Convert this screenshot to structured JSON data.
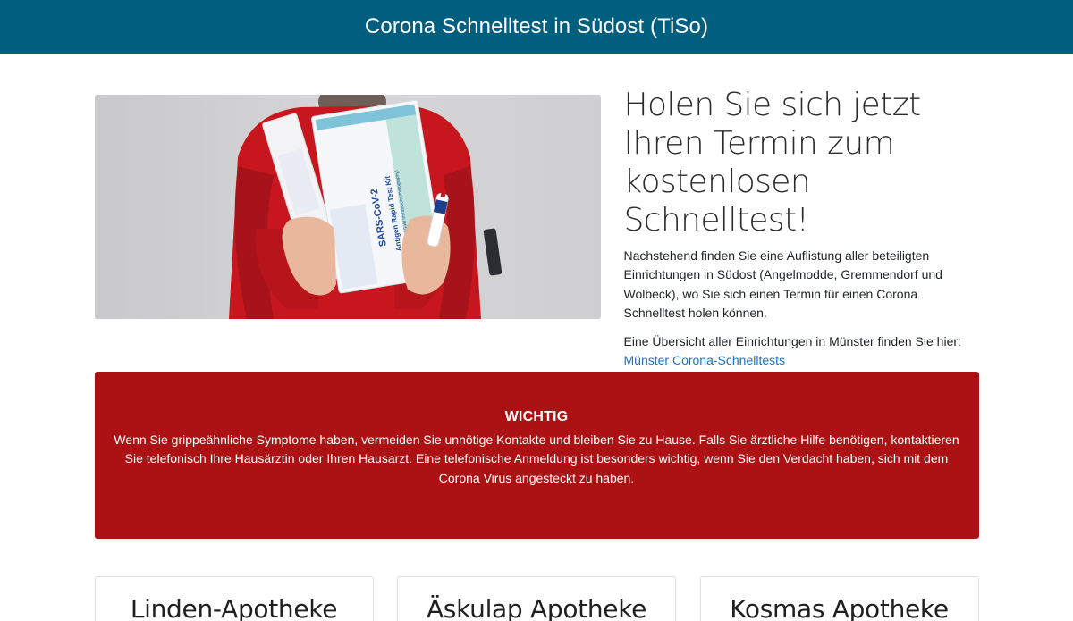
{
  "header": {
    "title": "Corona Schnelltest in Südost (TiSo)"
  },
  "hero": {
    "image_kit_label_1": "SARS-CoV-2",
    "image_kit_label_2": "Antigen Rapid Test Kit",
    "image_kit_label_3": "(Colloidal Gold Immunochromatography)",
    "heading": "Holen Sie sich jetzt Ihren Termin zum kostenlosen Schnelltest!",
    "paragraph": "Nachstehend finden Sie eine Auflistung aller beteiligten Einrichtungen in Südost (Angelmodde, Gremmendorf und Wolbeck), wo Sie sich einen Termin für einen Corona Schnelltest holen können.",
    "overview_text": "Eine Übersicht aller Einrichtungen in Münster finden Sie hier:",
    "overview_link": "Münster Corona-Schnelltests"
  },
  "alert": {
    "title": "WICHTIG",
    "body": "Wenn Sie grippeähnliche Symptome haben, vermeiden Sie unnötige Kontakte und bleiben Sie zu Hause. Falls Sie ärztliche Hilfe benötigen, kontaktieren Sie telefonisch Ihre Hausärztin oder Ihren Hausarzt. Eine telefonische Anmeldung ist besonders wichtig, wenn Sie den Verdacht haben, sich mit dem Corona Virus angesteckt zu haben."
  },
  "cards": [
    {
      "title": "Linden-Apotheke"
    },
    {
      "title": "Äskulap Apotheke"
    },
    {
      "title": "Kosmas Apotheke"
    }
  ],
  "colors": {
    "header_bg": "#005f7f",
    "alert_bg": "#ac1213",
    "link": "#1a73c9"
  }
}
